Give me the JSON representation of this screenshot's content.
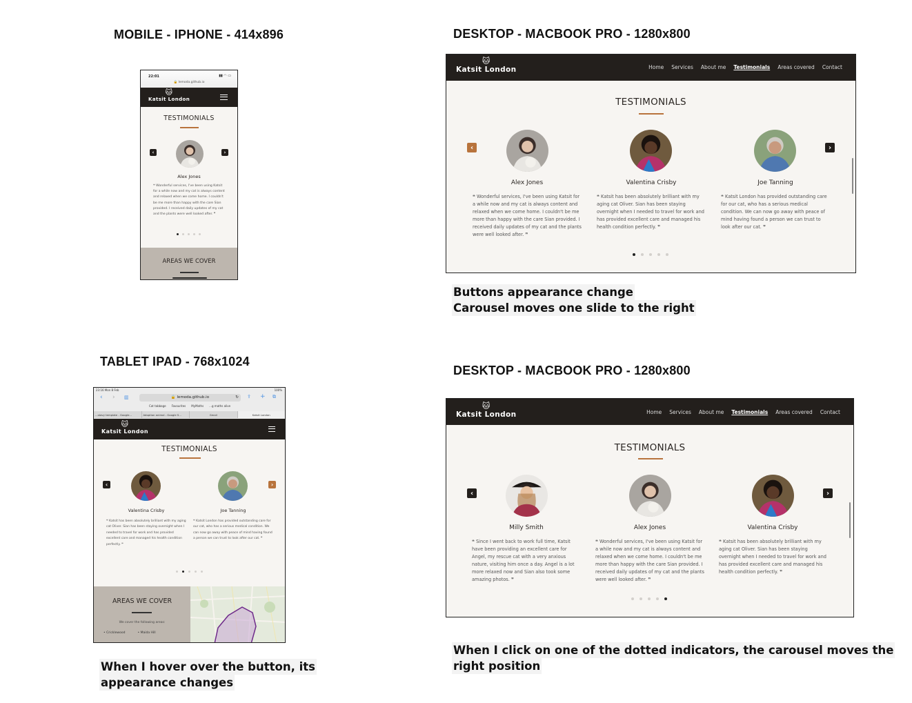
{
  "headings": {
    "mobile": "MOBILE - IPHONE - 414x896",
    "tablet": "TABLET IPAD - 768x1024",
    "desktop1": "DESKTOP -  MACBOOK PRO - 1280x800",
    "desktop2": "DESKTOP -  MACBOOK PRO - 1280x800"
  },
  "notes": {
    "tablet_line1": "When I hover over the button, its",
    "tablet_line2": "appearance changes",
    "desktop1_line1": "Buttons appearance change",
    "desktop1_line2": "Carousel moves one slide to the right",
    "desktop2_line1": "When I click on one of the dotted indicators, the carousel moves the",
    "desktop2_line2": "right position"
  },
  "site": {
    "brand": "Katsit London",
    "nav": [
      "Home",
      "Services",
      "About me",
      "Testimonials",
      "Areas covered",
      "Contact"
    ],
    "active_nav": "Testimonials",
    "section_title": "TESTIMONIALS",
    "areas_title": "AREAS WE COVER",
    "areas_intro": "We cover the following areas:",
    "areas_list": [
      "Cricklewood",
      "Maida Hill"
    ],
    "accent_color": "#b8733c",
    "nav_color": "#231f1c"
  },
  "mobile": {
    "status_time": "22:01",
    "url": "lemoda.github.io",
    "testimonial": {
      "name": "Alex Jones",
      "quote": "Wonderful services, I've been using Katsit for a while now and my cat is always content and relaxed when we come home. I couldn't be me more than happy with the care Sian provided. I received daily updates of my cat and the plants were well looked after."
    },
    "active_dot": 1,
    "dot_count": 5
  },
  "tablet": {
    "status_time": "23:16  Mon 8 Feb",
    "battery": "100%",
    "url": "lemoda.github.io",
    "bookmarks": [
      "Cat tabbage",
      "Favourites",
      "MyMaths",
      "...g maths alive"
    ],
    "tabs": [
      "...stavy template - Google...",
      "Adoption animal - Google S...",
      "Gmail",
      "Katsit London"
    ],
    "testimonials": [
      {
        "name": "Valentina Crisby",
        "quote": "Katsit has been absolutely brilliant with my aging cat Oliver. Sian has been staying overnight when I needed to travel for work and has provided excellent care and managed his health condition perfectly."
      },
      {
        "name": "Joe Tanning",
        "quote": "Katsit London has provided outstanding care for our cat, who has a serious medical condition. We can now go away with peace of mind having found a person we can trust to look after our cat."
      }
    ],
    "active_dot": 2,
    "dot_count": 5
  },
  "desktop1": {
    "testimonials": [
      {
        "name": "Alex Jones",
        "quote": "Wonderful services, I've been using Katsit for a while now and my cat is always content and relaxed when we come home. I couldn't be me more than happy with the care Sian provided. I received daily updates of my cat and the plants were well looked after."
      },
      {
        "name": "Valentina Crisby",
        "quote": "Katsit has been absolutely brilliant with my aging cat Oliver. Sian has been staying overnight when I needed to travel for work and has provided excellent care and managed his health condition perfectly."
      },
      {
        "name": "Joe Tanning",
        "quote": "Katsit London has provided outstanding care for our cat, who has a serious medical condition. We can now go away with peace of mind having found a person we can trust to look after our cat."
      }
    ],
    "active_dot": 1,
    "dot_count": 5
  },
  "desktop2": {
    "testimonials": [
      {
        "name": "Milly Smith",
        "quote": "Since I went back to work full time, Katsit have been providing an excellent care for Angel, my rescue cat with a very anxious nature, visiting him once a day. Angel is a lot more relaxed now and Sian also took some amazing photos."
      },
      {
        "name": "Alex Jones",
        "quote": "Wonderful services, I've been using Katsit for a while now and my cat is always content and relaxed when we come home. I couldn't be me more than happy with the care Sian provided. I received daily updates of my cat and the plants were well looked after."
      },
      {
        "name": "Valentina Crisby",
        "quote": "Katsit has been absolutely brilliant with my aging cat Oliver. Sian has been staying overnight when I needed to travel for work and has provided excellent care and managed his health condition perfectly."
      }
    ],
    "active_dot": 5,
    "dot_count": 5
  }
}
